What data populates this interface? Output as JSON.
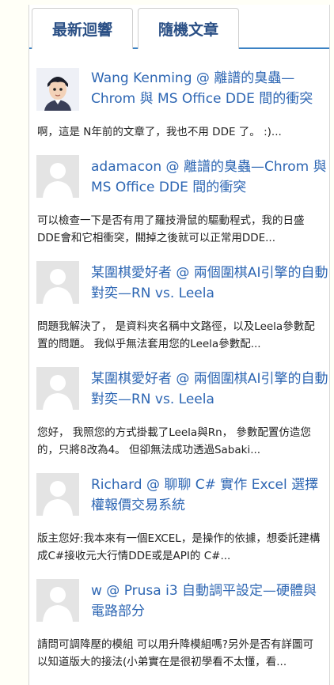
{
  "tabs": {
    "recent_comments": "最新迴響",
    "random_posts": "隨機文章"
  },
  "comments": [
    {
      "author": "Wang Kenming",
      "at": " @ ",
      "post": "離譜的臭蟲—Chrom 與 MS Office DDE 間的衝突",
      "excerpt": "啊，這是 N年前的文章了，我也不用 DDE 了。 :)...",
      "avatar": "cartoon-portrait"
    },
    {
      "author": "adamacon",
      "at": " @ ",
      "post": "離譜的臭蟲—Chrom 與 MS Office DDE 間的衝突",
      "excerpt": "可以檢查一下是否有用了羅技滑鼠的驅動程式，我的日盛DDE會和它相衝突，關掉之後就可以正常用DDE...",
      "avatar": "default"
    },
    {
      "author": "某圍棋愛好者",
      "at": " @ ",
      "post": "兩個圍棋AI引擎的自動對奕—RN vs. Leela",
      "excerpt": "問題我解決了， 是資料夾名稱中文路徑，以及Leela參數配置的問題。 我似乎無法套用您的Leela參數配...",
      "avatar": "default"
    },
    {
      "author": "某圍棋愛好者",
      "at": " @ ",
      "post": "兩個圍棋AI引擎的自動對奕—RN vs. Leela",
      "excerpt": "您好， 我照您的方式掛載了Leela與Rn， 參數配置仿造您的，只將8改為4。 但卻無法成功透過Sabaki...",
      "avatar": "default"
    },
    {
      "author": "Richard",
      "at": " @ ",
      "post": "聊聊 C# 實作 Excel 選擇權報價交易系統",
      "excerpt": "版主您好:我本來有一個EXCEL，是操作的依據，想委託建構成C#接收元大行情DDE或是API的 C#...",
      "avatar": "default"
    },
    {
      "author": "w",
      "at": " @ ",
      "post": "Prusa i3 自動調平設定—硬體與電路部分",
      "excerpt": "請問可調降壓的模組 可以用升降模組嗎?另外是否有詳圖可以知道版大的接法(小弟實在是很初學看不太懂，看...",
      "avatar": "default"
    }
  ]
}
